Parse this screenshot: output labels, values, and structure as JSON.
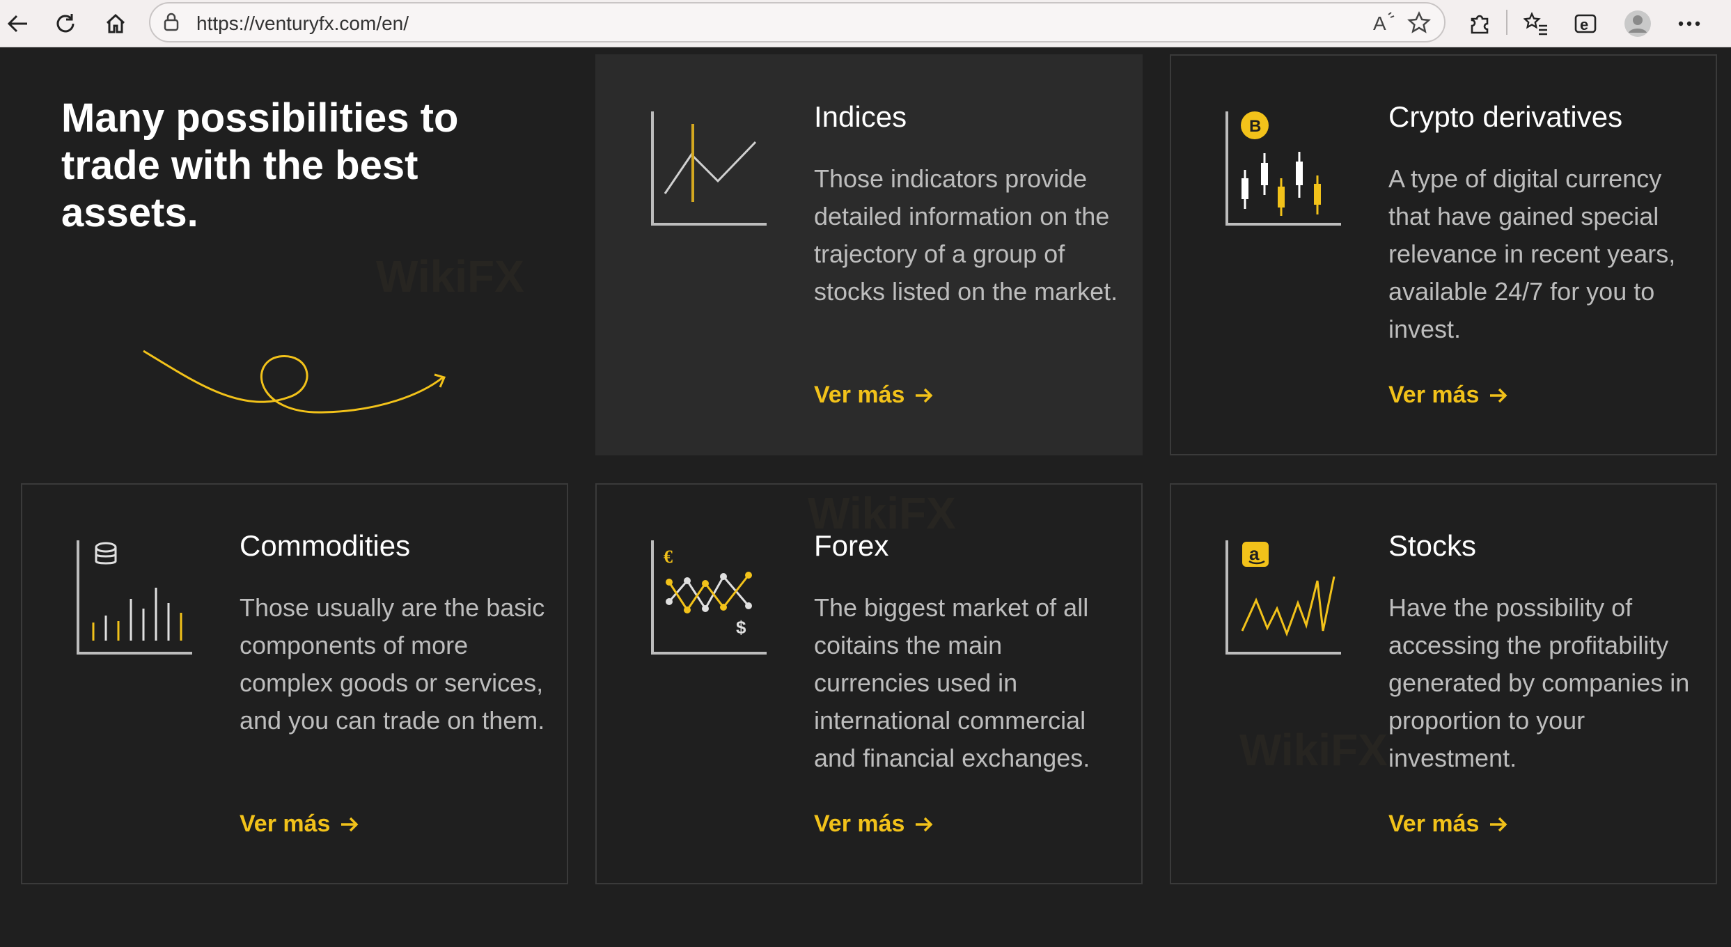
{
  "browser": {
    "url": "https://venturyfx.com/en/"
  },
  "hero": {
    "headline": "Many possibilities to trade with the best assets."
  },
  "cards": [
    {
      "title": "Indices",
      "description": "Those indicators provide detailed information on the trajectory of a group of stocks listed on the market.",
      "link": "Ver más",
      "icon": "line-chart-icon"
    },
    {
      "title": "Crypto derivatives",
      "description": "A type of digital currency that have gained special relevance in recent years, available 24/7 for you to invest.",
      "link": "Ver más",
      "icon": "bitcoin-candles-icon"
    },
    {
      "title": "Commodities",
      "description": "Those usually are the basic components of more complex goods or services, and you can trade on them.",
      "link": "Ver más",
      "icon": "coins-bars-icon"
    },
    {
      "title": "Forex",
      "description": "The biggest market of all coitains the main currencies used in international commercial and financial exchanges.",
      "link": "Ver más",
      "icon": "currency-exchange-icon"
    },
    {
      "title": "Stocks",
      "description": "Have the possibility of accessing the profitability generated by companies in proportion to your investment.",
      "link": "Ver más",
      "icon": "amazon-stock-icon"
    }
  ],
  "watermark": "WikiFX",
  "colors": {
    "background": "#1f1f1f",
    "card_active": "#2b2b2b",
    "accent": "#f2c21a",
    "text_muted": "#bdbdbd"
  }
}
